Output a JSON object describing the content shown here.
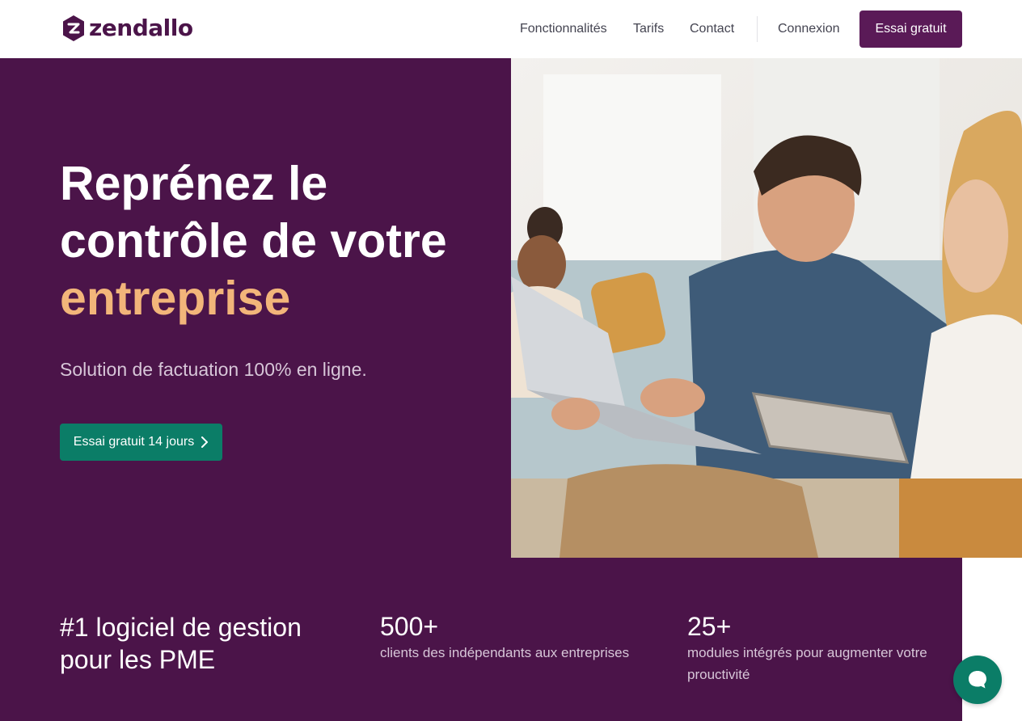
{
  "brand": {
    "name": "zendallo",
    "color": "#4b1449"
  },
  "nav": {
    "items": [
      {
        "label": "Fonctionnalités"
      },
      {
        "label": "Tarifs"
      },
      {
        "label": "Contact"
      }
    ],
    "login_label": "Connexion",
    "trial_label": "Essai gratuit"
  },
  "hero": {
    "title_line1": "Reprénez le",
    "title_line2": "contrôle de votre",
    "title_accent": "entreprise",
    "subtitle": "Solution de factuation 100% en ligne.",
    "cta_label": "Essai gratuit 14 jours",
    "cta_icon": "chevron-right-icon",
    "background": "#4b1449",
    "accent_color": "#f2b57a",
    "cta_color": "#0b7d67"
  },
  "stats": {
    "lead": "#1 logiciel de gestion pour les PME",
    "items": [
      {
        "value": "500+",
        "description": "clients des indépendants aux entreprises"
      },
      {
        "value": "25+",
        "description": "modules intégrés pour augmenter votre prouctivité"
      }
    ]
  },
  "chat": {
    "icon": "chat-bubble-icon"
  }
}
